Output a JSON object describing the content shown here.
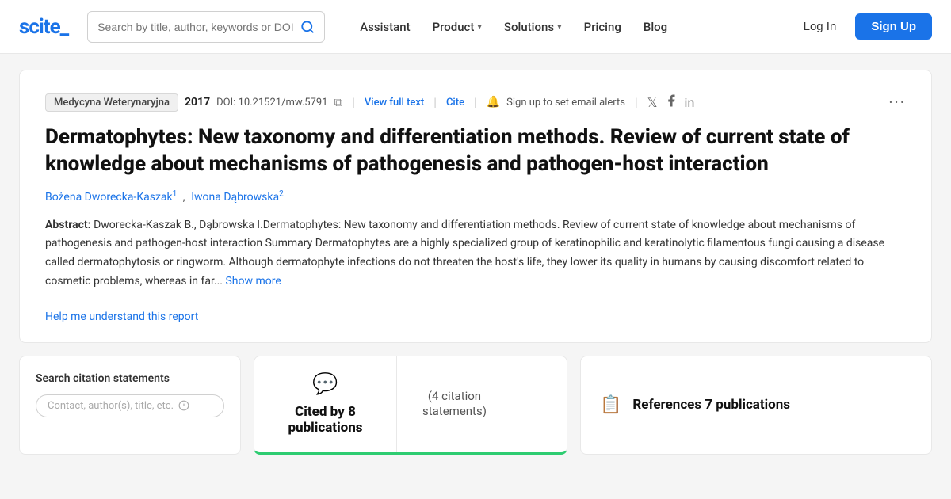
{
  "logo": {
    "text": "scite_"
  },
  "navbar": {
    "search_placeholder": "Search by title, author, keywords or DOI",
    "items": [
      {
        "label": "Assistant",
        "has_chevron": false
      },
      {
        "label": "Product",
        "has_chevron": true
      },
      {
        "label": "Solutions",
        "has_chevron": true
      },
      {
        "label": "Pricing",
        "has_chevron": false
      },
      {
        "label": "Blog",
        "has_chevron": false
      }
    ],
    "login_label": "Log In",
    "signup_label": "Sign Up"
  },
  "paper": {
    "journal": "Medycyna Weterynaryjna",
    "year": "2017",
    "doi": "DOI: 10.21521/mw.5791",
    "view_full_text": "View full text",
    "cite": "Cite",
    "alert_text": "Sign up to set email alerts",
    "title": "Dermatophytes: New taxonomy and differentiation methods. Review of current state of knowledge about mechanisms of pathogenesis and pathogen-host interaction",
    "authors": [
      {
        "name": "Bożena Dworecka-Kaszak",
        "sup": "1"
      },
      {
        "name": "Iwona Dąbrowska",
        "sup": "2"
      }
    ],
    "abstract_label": "Abstract:",
    "abstract_text": "Dworecka-Kaszak B., Dąbrowska I.Dermatophytes: New taxonomy and differentiation methods. Review of current state of knowledge about mechanisms of pathogenesis and pathogen-host interaction Summary Dermatophytes are a highly specialized group of keratinophilic and keratinolytic filamentous fungi causing a disease called dermatophytosis or ringworm. Although dermatophyte infections do not threaten the host's life, they lower its quality in humans by causing discomfort related to cosmetic problems, whereas in far...",
    "show_more": "Show more",
    "help_link": "Help me understand this report"
  },
  "bottom": {
    "search_panel": {
      "title": "Search citation statements",
      "placeholder": "Contact, author(s), title, etc."
    },
    "cited_panel": {
      "icon": "💬",
      "label": "Cited by 8 publications",
      "statements_label": "(4 citation",
      "statements_label2": "statements)"
    },
    "refs_panel": {
      "icon": "📋",
      "label": "References 7 publications"
    }
  },
  "colors": {
    "accent": "#1a73e8",
    "green": "#2ecc71",
    "border": "#e8e8e8"
  }
}
